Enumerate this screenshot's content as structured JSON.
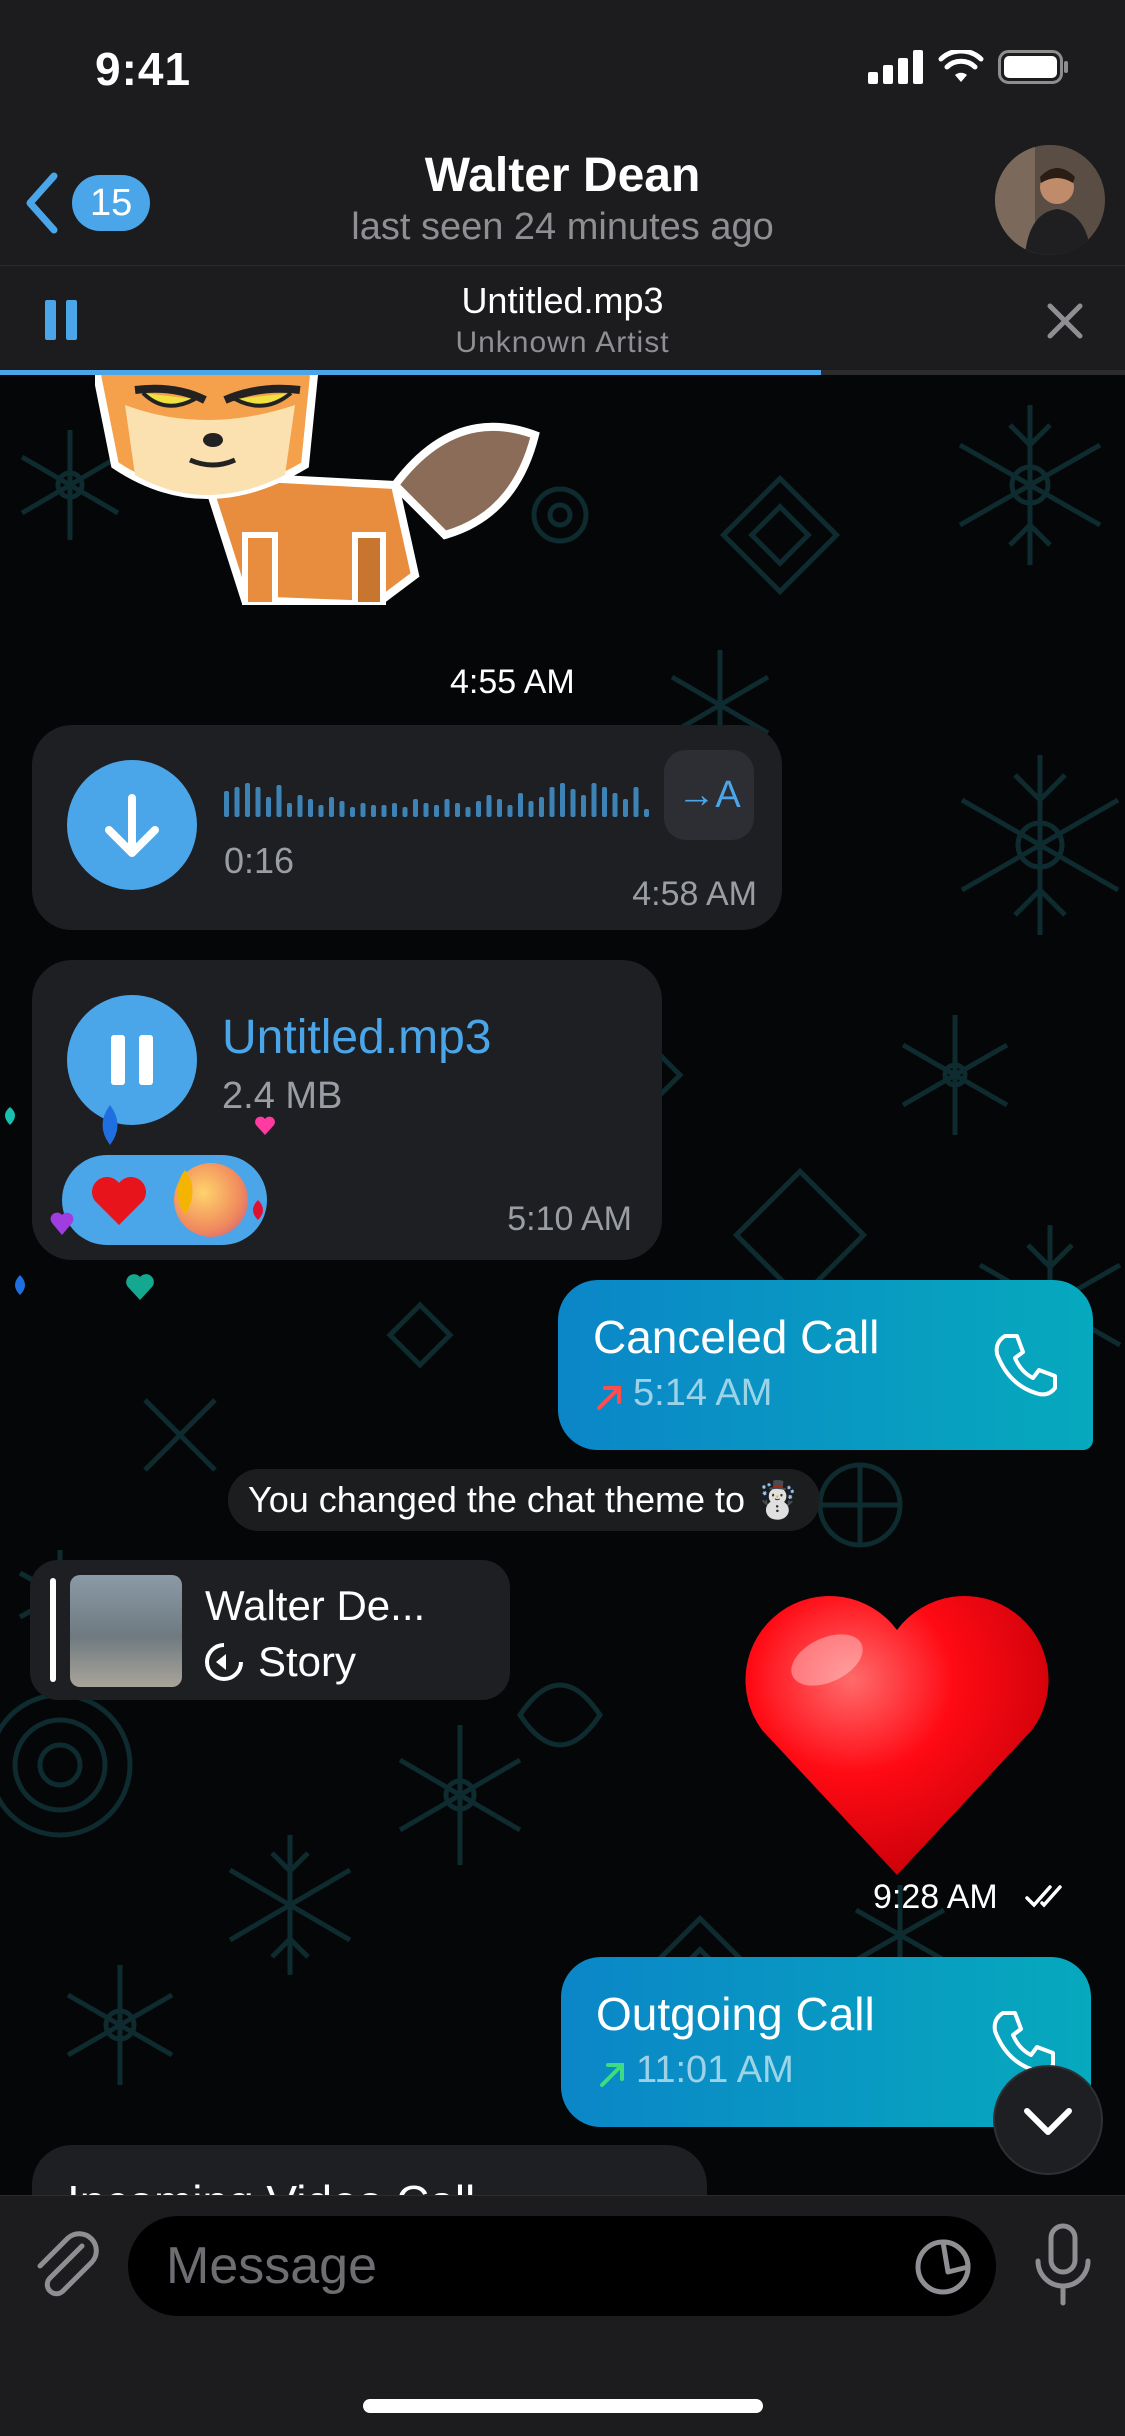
{
  "status": {
    "time": "9:41"
  },
  "nav": {
    "back_count": "15",
    "title": "Walter Dean",
    "subtitle": "last seen 24 minutes ago"
  },
  "player": {
    "title": "Untitled.mp3",
    "artist": "Unknown Artist",
    "progress": 0.73
  },
  "messages": {
    "sticker_time": "4:55 AM",
    "voice": {
      "duration": "0:16",
      "time": "4:58 AM",
      "transcribe_label": "→A"
    },
    "file": {
      "name": "Untitled.mp3",
      "size": "2.4 MB",
      "time": "5:10 AM"
    },
    "canceled_call": {
      "title": "Canceled Call",
      "time": "5:14 AM"
    },
    "service": {
      "text": "You changed the chat theme to",
      "emoji": "☃️"
    },
    "story": {
      "name": "Walter De...",
      "label": "Story"
    },
    "heart_time": "9:28 AM",
    "outgoing_call": {
      "title": "Outgoing Call",
      "time": "11:01 AM"
    },
    "partial_next": "Incoming Video Call"
  },
  "input": {
    "placeholder": "Message"
  },
  "colors": {
    "accent": "#4aa6e8",
    "bubble_out": "#0b86c8",
    "bubble_in": "#1e1f22",
    "canceled_arrow": "#ff4d4d",
    "outgoing_arrow": "#3ddc84"
  }
}
